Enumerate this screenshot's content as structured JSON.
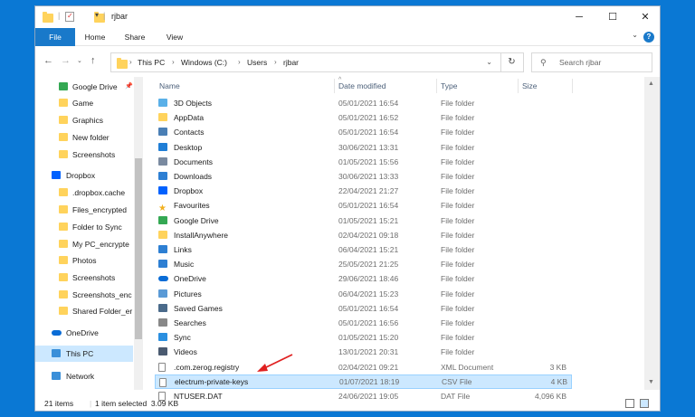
{
  "window": {
    "title": "rjbar"
  },
  "ribbon": {
    "tabs": [
      "File",
      "Home",
      "Share",
      "View"
    ]
  },
  "address": {
    "crumbs": [
      "This PC",
      "Windows (C:)",
      "Users",
      "rjbar"
    ]
  },
  "search": {
    "placeholder": "Search rjbar"
  },
  "sidebar": {
    "items": [
      {
        "label": "Google Drive",
        "icon": "google-drive-icon",
        "top": false
      },
      {
        "label": "Game",
        "icon": "folder-icon",
        "top": false
      },
      {
        "label": "Graphics",
        "icon": "folder-icon",
        "top": false
      },
      {
        "label": "New folder",
        "icon": "folder-icon",
        "top": false
      },
      {
        "label": "Screenshots",
        "icon": "folder-icon",
        "top": false
      },
      {
        "label": "Dropbox",
        "icon": "dropbox-icon",
        "top": true
      },
      {
        "label": ".dropbox.cache",
        "icon": "folder-icon",
        "top": false
      },
      {
        "label": "Files_encrypted",
        "icon": "folder-icon",
        "top": false
      },
      {
        "label": "Folder to Sync",
        "icon": "folder-icon",
        "top": false
      },
      {
        "label": "My PC_encrypte",
        "icon": "folder-icon",
        "top": false
      },
      {
        "label": "Photos",
        "icon": "folder-icon",
        "top": false
      },
      {
        "label": "Screenshots",
        "icon": "folder-shared-icon",
        "top": false
      },
      {
        "label": "Screenshots_enc",
        "icon": "folder-icon",
        "top": false
      },
      {
        "label": "Shared Folder_er",
        "icon": "folder-icon",
        "top": false
      },
      {
        "label": "OneDrive",
        "icon": "onedrive-icon",
        "top": true
      },
      {
        "label": "This PC",
        "icon": "computer-icon",
        "top": true,
        "selected": true
      },
      {
        "label": "Network",
        "icon": "network-icon",
        "top": true
      }
    ]
  },
  "columns": {
    "name": "Name",
    "date": "Date modified",
    "type": "Type",
    "size": "Size"
  },
  "files": [
    {
      "name": "3D Objects",
      "date": "05/01/2021 16:54",
      "type": "File folder",
      "size": "",
      "icon": "3d-objects-icon"
    },
    {
      "name": "AppData",
      "date": "05/01/2021 16:52",
      "type": "File folder",
      "size": "",
      "icon": "folder-icon"
    },
    {
      "name": "Contacts",
      "date": "05/01/2021 16:54",
      "type": "File folder",
      "size": "",
      "icon": "contacts-icon"
    },
    {
      "name": "Desktop",
      "date": "30/06/2021 13:31",
      "type": "File folder",
      "size": "",
      "icon": "desktop-icon"
    },
    {
      "name": "Documents",
      "date": "01/05/2021 15:56",
      "type": "File folder",
      "size": "",
      "icon": "documents-icon"
    },
    {
      "name": "Downloads",
      "date": "30/06/2021 13:33",
      "type": "File folder",
      "size": "",
      "icon": "downloads-icon"
    },
    {
      "name": "Dropbox",
      "date": "22/04/2021 21:27",
      "type": "File folder",
      "size": "",
      "icon": "dropbox-icon"
    },
    {
      "name": "Favourites",
      "date": "05/01/2021 16:54",
      "type": "File folder",
      "size": "",
      "icon": "star-icon"
    },
    {
      "name": "Google Drive",
      "date": "01/05/2021 15:21",
      "type": "File folder",
      "size": "",
      "icon": "google-drive-icon"
    },
    {
      "name": "InstallAnywhere",
      "date": "02/04/2021 09:18",
      "type": "File folder",
      "size": "",
      "icon": "folder-icon"
    },
    {
      "name": "Links",
      "date": "06/04/2021 15:21",
      "type": "File folder",
      "size": "",
      "icon": "links-icon"
    },
    {
      "name": "Music",
      "date": "25/05/2021 21:25",
      "type": "File folder",
      "size": "",
      "icon": "music-icon"
    },
    {
      "name": "OneDrive",
      "date": "29/06/2021 18:46",
      "type": "File folder",
      "size": "",
      "icon": "onedrive-icon"
    },
    {
      "name": "Pictures",
      "date": "06/04/2021 15:23",
      "type": "File folder",
      "size": "",
      "icon": "pictures-icon"
    },
    {
      "name": "Saved Games",
      "date": "05/01/2021 16:54",
      "type": "File folder",
      "size": "",
      "icon": "saved-games-icon"
    },
    {
      "name": "Searches",
      "date": "05/01/2021 16:56",
      "type": "File folder",
      "size": "",
      "icon": "searches-icon"
    },
    {
      "name": "Sync",
      "date": "01/05/2021 15:20",
      "type": "File folder",
      "size": "",
      "icon": "sync-icon"
    },
    {
      "name": "Videos",
      "date": "13/01/2021 20:31",
      "type": "File folder",
      "size": "",
      "icon": "videos-icon"
    },
    {
      "name": ".com.zerog.registry",
      "date": "02/04/2021 09:21",
      "type": "XML Document",
      "size": "3 KB",
      "icon": "file-icon"
    },
    {
      "name": "electrum-private-keys",
      "date": "01/07/2021 18:19",
      "type": "CSV File",
      "size": "4 KB",
      "icon": "csv-file-icon",
      "selected": true
    },
    {
      "name": "NTUSER.DAT",
      "date": "24/06/2021 19:05",
      "type": "DAT File",
      "size": "4,096 KB",
      "icon": "file-icon"
    }
  ],
  "status": {
    "count": "21 items",
    "selection": "1 item selected  3.09 KB"
  },
  "colors": {
    "accent": "#1979ca",
    "selection": "#cce8ff",
    "folder": "#ffd35c",
    "arrow": "#e02020"
  }
}
